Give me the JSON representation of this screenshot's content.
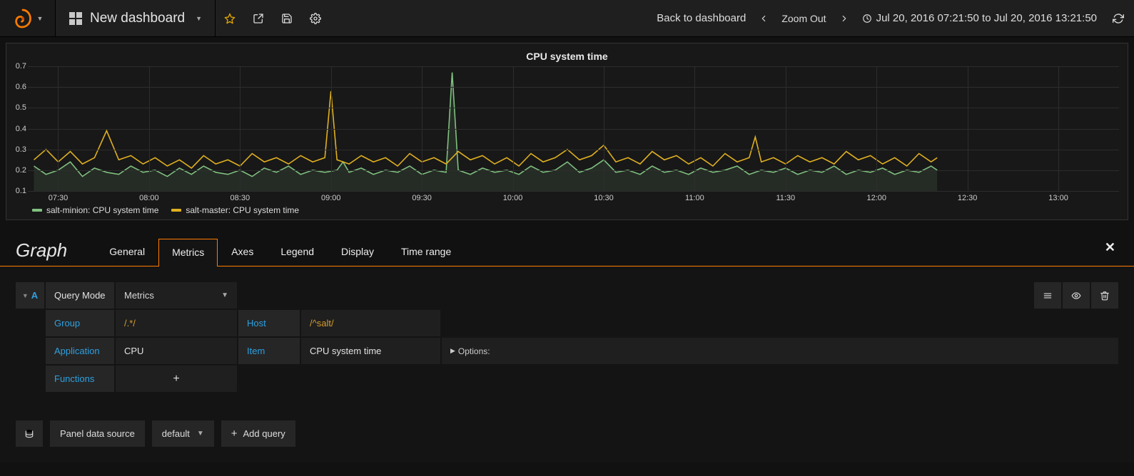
{
  "nav": {
    "dashboard_title": "New dashboard",
    "back_label": "Back to dashboard",
    "zoom_label": "Zoom Out",
    "time_range": "Jul 20, 2016 07:21:50 to Jul 20, 2016 13:21:50"
  },
  "panel": {
    "title": "CPU system time",
    "legend": [
      {
        "label": "salt-minion: CPU system time",
        "color": "#80c080"
      },
      {
        "label": "salt-master: CPU system time",
        "color": "#e0b020"
      }
    ]
  },
  "editor": {
    "title": "Graph",
    "tabs": [
      "General",
      "Metrics",
      "Axes",
      "Legend",
      "Display",
      "Time range"
    ],
    "active_tab": "Metrics"
  },
  "query": {
    "letter": "A",
    "mode_label": "Query Mode",
    "mode_value": "Metrics",
    "group_label": "Group",
    "group_value": "/.*/",
    "host_label": "Host",
    "host_value": "/^salt/",
    "application_label": "Application",
    "application_value": "CPU",
    "item_label": "Item",
    "item_value": "CPU system time",
    "options_label": "Options:",
    "functions_label": "Functions"
  },
  "footer": {
    "ds_label": "Panel data source",
    "ds_value": "default",
    "add_query": "Add query"
  },
  "chart_data": {
    "type": "line",
    "title": "CPU system time",
    "xlabel": "",
    "ylabel": "",
    "ylim": [
      0.1,
      0.7
    ],
    "x_ticks": [
      "07:30",
      "08:00",
      "08:30",
      "09:00",
      "09:30",
      "10:00",
      "10:30",
      "11:00",
      "11:30",
      "12:00",
      "12:30",
      "13:00"
    ],
    "y_ticks": [
      0.1,
      0.2,
      0.3,
      0.4,
      0.5,
      0.6,
      0.7
    ],
    "x_range_minutes": [
      440,
      800
    ],
    "series": [
      {
        "name": "salt-minion: CPU system time",
        "color": "#80c080",
        "fill": true,
        "values": [
          [
            442,
            0.22
          ],
          [
            446,
            0.18
          ],
          [
            450,
            0.2
          ],
          [
            454,
            0.24
          ],
          [
            458,
            0.17
          ],
          [
            462,
            0.21
          ],
          [
            466,
            0.19
          ],
          [
            470,
            0.18
          ],
          [
            474,
            0.22
          ],
          [
            478,
            0.19
          ],
          [
            482,
            0.2
          ],
          [
            486,
            0.17
          ],
          [
            490,
            0.21
          ],
          [
            494,
            0.18
          ],
          [
            498,
            0.22
          ],
          [
            502,
            0.19
          ],
          [
            506,
            0.18
          ],
          [
            510,
            0.2
          ],
          [
            514,
            0.17
          ],
          [
            518,
            0.21
          ],
          [
            522,
            0.19
          ],
          [
            526,
            0.22
          ],
          [
            530,
            0.18
          ],
          [
            534,
            0.2
          ],
          [
            538,
            0.19
          ],
          [
            542,
            0.2
          ],
          [
            544,
            0.24
          ],
          [
            546,
            0.19
          ],
          [
            550,
            0.21
          ],
          [
            554,
            0.18
          ],
          [
            558,
            0.2
          ],
          [
            562,
            0.19
          ],
          [
            566,
            0.22
          ],
          [
            570,
            0.18
          ],
          [
            574,
            0.2
          ],
          [
            578,
            0.19
          ],
          [
            580,
            0.67
          ],
          [
            582,
            0.2
          ],
          [
            586,
            0.18
          ],
          [
            590,
            0.21
          ],
          [
            594,
            0.19
          ],
          [
            598,
            0.2
          ],
          [
            602,
            0.18
          ],
          [
            606,
            0.22
          ],
          [
            610,
            0.19
          ],
          [
            614,
            0.2
          ],
          [
            618,
            0.24
          ],
          [
            622,
            0.19
          ],
          [
            626,
            0.21
          ],
          [
            630,
            0.25
          ],
          [
            634,
            0.19
          ],
          [
            638,
            0.2
          ],
          [
            642,
            0.18
          ],
          [
            646,
            0.22
          ],
          [
            650,
            0.19
          ],
          [
            654,
            0.2
          ],
          [
            658,
            0.18
          ],
          [
            662,
            0.21
          ],
          [
            666,
            0.19
          ],
          [
            670,
            0.2
          ],
          [
            674,
            0.22
          ],
          [
            678,
            0.18
          ],
          [
            682,
            0.2
          ],
          [
            686,
            0.19
          ],
          [
            690,
            0.21
          ],
          [
            694,
            0.18
          ],
          [
            698,
            0.2
          ],
          [
            702,
            0.19
          ],
          [
            706,
            0.22
          ],
          [
            710,
            0.18
          ],
          [
            714,
            0.2
          ],
          [
            718,
            0.19
          ],
          [
            722,
            0.21
          ],
          [
            726,
            0.18
          ],
          [
            730,
            0.2
          ],
          [
            734,
            0.19
          ],
          [
            738,
            0.22
          ],
          [
            740,
            0.2
          ]
        ]
      },
      {
        "name": "salt-master: CPU system time",
        "color": "#e0b020",
        "fill": false,
        "values": [
          [
            442,
            0.25
          ],
          [
            446,
            0.3
          ],
          [
            450,
            0.24
          ],
          [
            454,
            0.29
          ],
          [
            458,
            0.23
          ],
          [
            462,
            0.26
          ],
          [
            466,
            0.39
          ],
          [
            470,
            0.25
          ],
          [
            474,
            0.27
          ],
          [
            478,
            0.23
          ],
          [
            482,
            0.26
          ],
          [
            486,
            0.22
          ],
          [
            490,
            0.25
          ],
          [
            494,
            0.21
          ],
          [
            498,
            0.27
          ],
          [
            502,
            0.23
          ],
          [
            506,
            0.25
          ],
          [
            510,
            0.22
          ],
          [
            514,
            0.28
          ],
          [
            518,
            0.24
          ],
          [
            522,
            0.26
          ],
          [
            526,
            0.23
          ],
          [
            530,
            0.27
          ],
          [
            534,
            0.24
          ],
          [
            538,
            0.26
          ],
          [
            540,
            0.58
          ],
          [
            542,
            0.25
          ],
          [
            546,
            0.23
          ],
          [
            550,
            0.27
          ],
          [
            554,
            0.24
          ],
          [
            558,
            0.26
          ],
          [
            562,
            0.22
          ],
          [
            566,
            0.28
          ],
          [
            570,
            0.24
          ],
          [
            574,
            0.26
          ],
          [
            578,
            0.23
          ],
          [
            582,
            0.29
          ],
          [
            586,
            0.25
          ],
          [
            590,
            0.27
          ],
          [
            594,
            0.23
          ],
          [
            598,
            0.26
          ],
          [
            602,
            0.22
          ],
          [
            606,
            0.28
          ],
          [
            610,
            0.24
          ],
          [
            614,
            0.26
          ],
          [
            618,
            0.3
          ],
          [
            622,
            0.25
          ],
          [
            626,
            0.27
          ],
          [
            630,
            0.32
          ],
          [
            634,
            0.24
          ],
          [
            638,
            0.26
          ],
          [
            642,
            0.23
          ],
          [
            646,
            0.29
          ],
          [
            650,
            0.25
          ],
          [
            654,
            0.27
          ],
          [
            658,
            0.23
          ],
          [
            662,
            0.26
          ],
          [
            666,
            0.22
          ],
          [
            670,
            0.28
          ],
          [
            674,
            0.24
          ],
          [
            678,
            0.26
          ],
          [
            680,
            0.36
          ],
          [
            682,
            0.24
          ],
          [
            686,
            0.26
          ],
          [
            690,
            0.23
          ],
          [
            694,
            0.27
          ],
          [
            698,
            0.24
          ],
          [
            702,
            0.26
          ],
          [
            706,
            0.23
          ],
          [
            710,
            0.29
          ],
          [
            714,
            0.25
          ],
          [
            718,
            0.27
          ],
          [
            722,
            0.23
          ],
          [
            726,
            0.26
          ],
          [
            730,
            0.22
          ],
          [
            734,
            0.28
          ],
          [
            738,
            0.24
          ],
          [
            740,
            0.26
          ]
        ]
      }
    ]
  }
}
